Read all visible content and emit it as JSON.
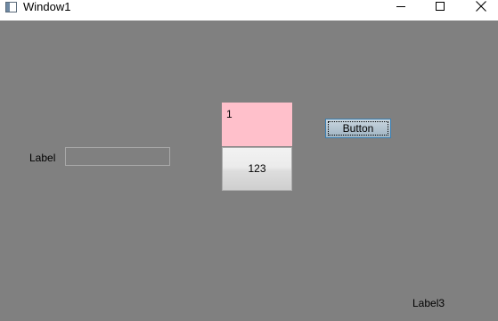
{
  "window": {
    "title": "Window1",
    "icon": "app-window-icon",
    "caption_buttons": {
      "minimize": "minimize-icon",
      "maximize": "maximize-icon",
      "close": "close-icon"
    },
    "background_color": "#808080"
  },
  "content": {
    "left_label": "Label",
    "text_input": {
      "value": "",
      "placeholder": ""
    },
    "pink_box": {
      "text": "1",
      "color": "#ffc0cb"
    },
    "number_button": "123",
    "main_button": "Button",
    "bottom_label": "Label3"
  }
}
